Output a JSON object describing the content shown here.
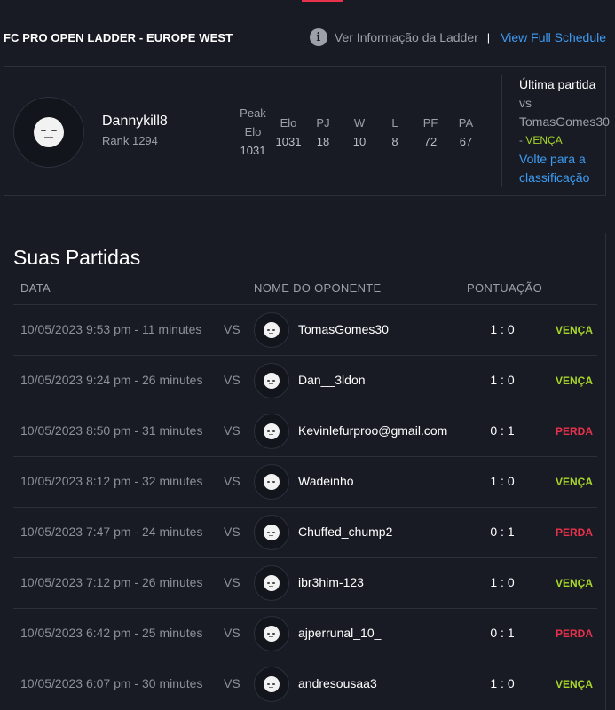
{
  "header": {
    "ladder_title": "FC PRO OPEN LADDER - EUROPE WEST",
    "info_link": "Ver Informação da Ladder",
    "separator": "|",
    "schedule_link": "View Full Schedule",
    "icon": "info-icon"
  },
  "player": {
    "name": "Dannykill8",
    "rank": "Rank 1294",
    "stats": {
      "peak_elo_label_1": "Peak",
      "peak_elo_label_2": "Elo",
      "peak_elo": "1031",
      "elo_label": "Elo",
      "elo": "1031",
      "pj_label": "PJ",
      "pj": "18",
      "w_label": "W",
      "w": "10",
      "l_label": "L",
      "l": "8",
      "pf_label": "PF",
      "pf": "72",
      "pa_label": "PA",
      "pa": "67"
    }
  },
  "last_match": {
    "title": "Última partida",
    "vs": "vs",
    "opponent": "TomasGomes30",
    "result_prefix": "- ",
    "result": "VENÇA",
    "back_link": "Volte para a classificação"
  },
  "matches": {
    "title": "Suas Partidas",
    "columns": {
      "date": "DATA",
      "opponent": "NOME DO OPONENTE",
      "score": "PONTUAÇÃO"
    },
    "vs_label": "VS",
    "rows": [
      {
        "date": "10/05/2023 9:53 pm - 11 minutes",
        "opponent": "TomasGomes30",
        "score": "1 : 0",
        "result": "VENÇA",
        "outcome": "win"
      },
      {
        "date": "10/05/2023 9:24 pm - 26 minutes",
        "opponent": "Dan__3ldon",
        "score": "1 : 0",
        "result": "VENÇA",
        "outcome": "win"
      },
      {
        "date": "10/05/2023 8:50 pm - 31 minutes",
        "opponent": "Kevinlefurproo@gmail.com",
        "score": "0 : 1",
        "result": "PERDA",
        "outcome": "loss"
      },
      {
        "date": "10/05/2023 8:12 pm - 32 minutes",
        "opponent": "Wadeinho",
        "score": "1 : 0",
        "result": "VENÇA",
        "outcome": "win"
      },
      {
        "date": "10/05/2023 7:47 pm - 24 minutes",
        "opponent": "Chuffed_chump2",
        "score": "0 : 1",
        "result": "PERDA",
        "outcome": "loss"
      },
      {
        "date": "10/05/2023 7:12 pm - 26 minutes",
        "opponent": "ibr3him-123",
        "score": "1 : 0",
        "result": "VENÇA",
        "outcome": "win"
      },
      {
        "date": "10/05/2023 6:42 pm - 25 minutes",
        "opponent": "ajperrunal_10_",
        "score": "0 : 1",
        "result": "PERDA",
        "outcome": "loss"
      },
      {
        "date": "10/05/2023 6:07 pm - 30 minutes",
        "opponent": "andresousaa3",
        "score": "1 : 0",
        "result": "VENÇA",
        "outcome": "win"
      }
    ]
  },
  "colors": {
    "background": "#181b24",
    "link": "#3e9bf2",
    "win": "#a8d628",
    "loss": "#e8314a",
    "muted": "#9da0a8"
  }
}
